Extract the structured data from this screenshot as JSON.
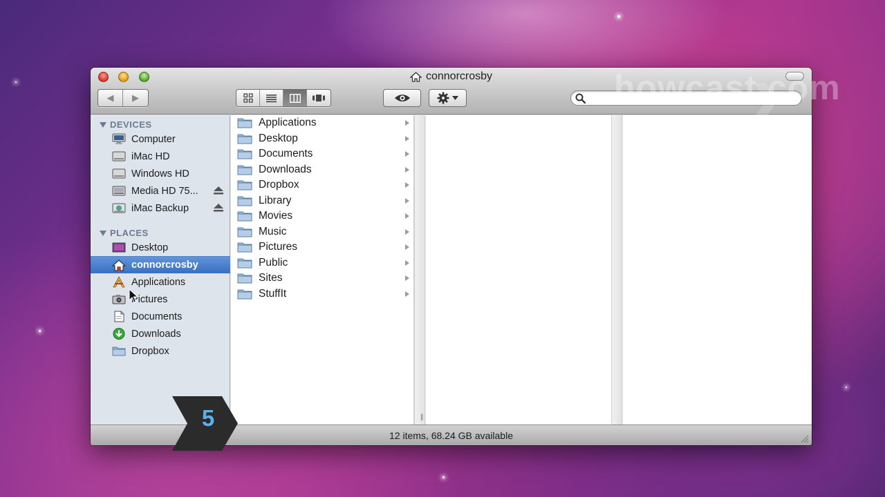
{
  "window": {
    "title": "connorcrosby",
    "search_placeholder": ""
  },
  "toolbar": {
    "back_glyph": "◀",
    "forward_glyph": "▶",
    "active_view": "columns"
  },
  "sidebar": {
    "devices_header": "DEVICES",
    "places_header": "PLACES",
    "devices": [
      {
        "label": "Computer",
        "icon": "computer-icon"
      },
      {
        "label": "iMac HD",
        "icon": "hard-drive-icon"
      },
      {
        "label": "Windows HD",
        "icon": "hard-drive-icon"
      },
      {
        "label": "Media HD 75...",
        "icon": "hard-drive-icon",
        "eject": true
      },
      {
        "label": "iMac Backup",
        "icon": "backup-drive-icon",
        "eject": true
      }
    ],
    "places": [
      {
        "label": "Desktop",
        "icon": "desktop-icon"
      },
      {
        "label": "connorcrosby",
        "icon": "home-icon",
        "selected": true
      },
      {
        "label": "Applications",
        "icon": "applications-icon"
      },
      {
        "label": "Pictures",
        "icon": "camera-icon"
      },
      {
        "label": "Documents",
        "icon": "document-icon"
      },
      {
        "label": "Downloads",
        "icon": "download-icon"
      },
      {
        "label": "Dropbox",
        "icon": "folder-icon"
      }
    ]
  },
  "column1": {
    "items": [
      "Applications",
      "Desktop",
      "Documents",
      "Downloads",
      "Dropbox",
      "Library",
      "Movies",
      "Music",
      "Pictures",
      "Public",
      "Sites",
      "StuffIt"
    ]
  },
  "status": {
    "text": "12 items, 68.24 GB available"
  },
  "overlay": {
    "watermark": "howcast.com",
    "step_number": "5"
  },
  "colors": {
    "selection": "#3a6fc2",
    "sidebar_bg": "#dde4ec",
    "step_badge": "#2b2b2b",
    "step_number": "#5cb0e8"
  }
}
